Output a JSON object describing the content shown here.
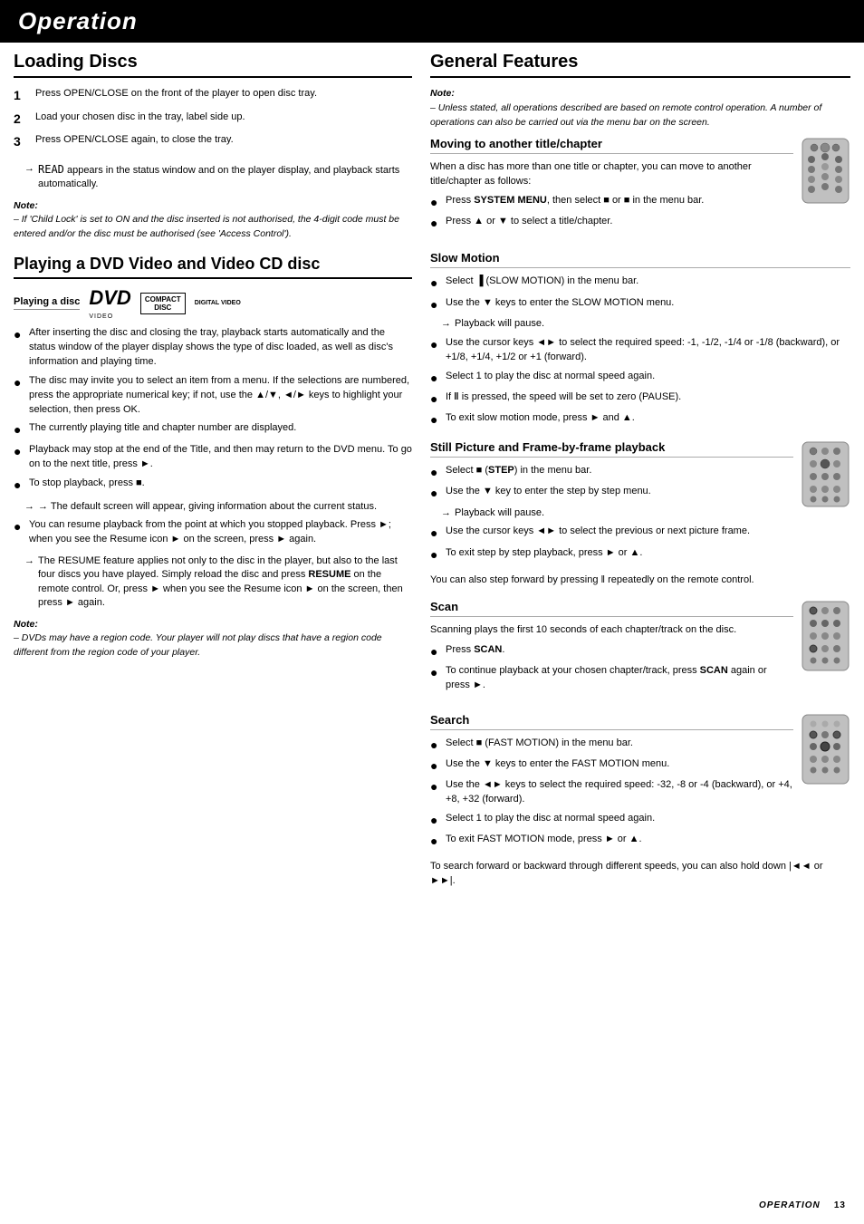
{
  "header": {
    "title": "Operation"
  },
  "footer": {
    "label": "Operation",
    "page_num": "13"
  },
  "left": {
    "loading_discs": {
      "title": "Loading Discs",
      "steps": [
        {
          "num": "1",
          "text": "Press OPEN/CLOSE on the front of the player to open disc tray."
        },
        {
          "num": "2",
          "text": "Load your chosen disc in the tray, label side up."
        },
        {
          "num": "3",
          "text": "Press OPEN/CLOSE again, to close the tray."
        }
      ],
      "step3_arrow": "→ READ appears in the status window and on the player display, and playback starts automatically.",
      "note_label": "Note:",
      "note_text": "– If 'Child Lock' is set to ON and the disc inserted is not authorised, the 4-digit code must be entered and/or the disc must be authorised (see 'Access Control')."
    },
    "playing_dvd": {
      "title": "Playing a DVD Video and Video CD disc",
      "sub_title": "Playing a disc",
      "bullets": [
        "After inserting the disc and closing the tray, playback starts automatically and the status window of the player display shows the type of disc loaded, as well as disc's information and playing time.",
        "The disc may invite you to select an item from a menu. If the selections are numbered, press the appropriate numerical key; if not, use the ▲/▼, ◄/► keys to highlight your selection, then press OK.",
        "The currently playing title and chapter number are displayed.",
        "Playback may stop at the end of the Title, and then may return to the DVD menu. To go on to the next title, press ►.",
        "To stop playback, press ■."
      ],
      "stop_arrow": "→ The default screen will appear, giving information about the current status.",
      "resume_bullet": "You can resume playback from the point at which you stopped playback. Press ►; when you see the Resume icon ► on the screen, press ► again.",
      "resume_arrow": "→ The RESUME feature applies not only to the disc in the player, but also to the last four discs you have played. Simply reload the disc and press RESUME on the remote control. Or, press ► when you see the Resume icon ► on the screen, then press ► again.",
      "note2_label": "Note:",
      "note2_text": "– DVDs may have a region code. Your player will not play discs that have a region code different from the region code of your player."
    }
  },
  "right": {
    "general_features": {
      "title": "General Features"
    },
    "note": {
      "label": "Note:",
      "text": "– Unless stated, all operations described are based on remote control operation. A number of operations can also be carried out via the menu bar on the screen."
    },
    "moving_title": {
      "title": "Moving to another title/chapter",
      "intro": "When a disc has more than one title or chapter, you can move to another title/chapter as follows:",
      "bullets": [
        "Press SYSTEM MENU, then select ■ or ■ in the menu bar.",
        "Press ▲ or ▼ to select a title/chapter."
      ]
    },
    "slow_motion": {
      "title": "Slow Motion",
      "bullets": [
        "Select ▐ (SLOW MOTION) in the menu bar.",
        "Use the ▼ keys to enter the SLOW MOTION menu.",
        "→ Playback will pause.",
        "Use the cursor keys ◄► to select the required speed: -1, -1/2, -1/4 or -1/8 (backward), or +1/8, +1/4, +1/2 or +1 (forward).",
        "Select 1 to play the disc at normal speed again.",
        "If ‖ is pressed, the speed will be set to zero (PAUSE).",
        "To exit slow motion mode, press ► and ▲."
      ]
    },
    "still_picture": {
      "title": "Still Picture and Frame-by-frame playback",
      "bullets": [
        "Select ■ (STEP) in the menu bar.",
        "Use the ▼ key to enter the step by step menu.",
        "→ Playback will pause.",
        "Use the cursor keys ◄► to select the previous or next picture frame.",
        "To exit step by step playback, press ► or ▲."
      ],
      "extra_text": "You can also step forward by pressing ‖ repeatedly on the remote control."
    },
    "scan": {
      "title": "Scan",
      "intro": "Scanning plays the first 10 seconds of each chapter/track on the disc.",
      "bullets": [
        "Press SCAN.",
        "To continue playback at your chosen chapter/track, press SCAN again or press ►."
      ]
    },
    "search": {
      "title": "Search",
      "bullets": [
        "Select ■ (FAST MOTION) in the menu bar.",
        "Use the ▼ keys to enter the FAST MOTION menu.",
        "Use the ◄► keys to select the required speed: -32, -8 or -4 (backward), or +4, +8, +32 (forward).",
        "Select 1 to play the disc at normal speed again.",
        "To exit FAST MOTION mode, press ► or ▲."
      ],
      "extra_text": "To search forward or backward through different speeds, you can also hold down |◄◄ or ►►|."
    }
  }
}
